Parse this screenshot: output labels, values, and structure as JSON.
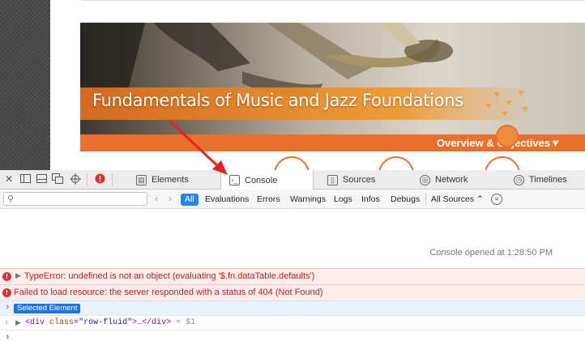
{
  "page": {
    "hero_title": "Fundamentals of Music and Jazz Foundations",
    "overview_link": "Overview & Objectives▼"
  },
  "devtools": {
    "toolbar_icons": [
      "close-icon",
      "dock-side-icon",
      "dock-bottom-icon",
      "undock-icon",
      "inspect-element-icon",
      "error-count-icon"
    ],
    "tabs": [
      {
        "label": "Elements",
        "icon": "elements-icon"
      },
      {
        "label": "Console",
        "icon": "console-icon"
      },
      {
        "label": "Sources",
        "icon": "sources-icon"
      },
      {
        "label": "Network",
        "icon": "network-icon"
      },
      {
        "label": "Timelines",
        "icon": "timelines-icon"
      }
    ],
    "active_tab": "Console",
    "search": {
      "value": "",
      "placeholder": ""
    },
    "filters": [
      "All",
      "Evaluations",
      "Errors",
      "Warnings",
      "Logs",
      "Infos",
      "Debugs"
    ],
    "active_filter": "All",
    "sources_select": "All Sources",
    "accent_color": "#1e88f6"
  },
  "console": {
    "opened_message": "Console opened at 1:28:50 PM",
    "errors": [
      {
        "text": "TypeError: undefined is not an object (evaluating '$.fn.dataTable.defaults')",
        "expandable": true
      },
      {
        "text": "Failed to load resource: the server responded with a status of 404 (Not Found)",
        "expandable": false
      }
    ],
    "selected_element_badge": "Selected Element",
    "result": {
      "tag_open": "<div",
      "attr_name": "class",
      "attr_value": "\"row-fluid\"",
      "tag_rest": ">…</div>",
      "var": "= $1"
    }
  }
}
